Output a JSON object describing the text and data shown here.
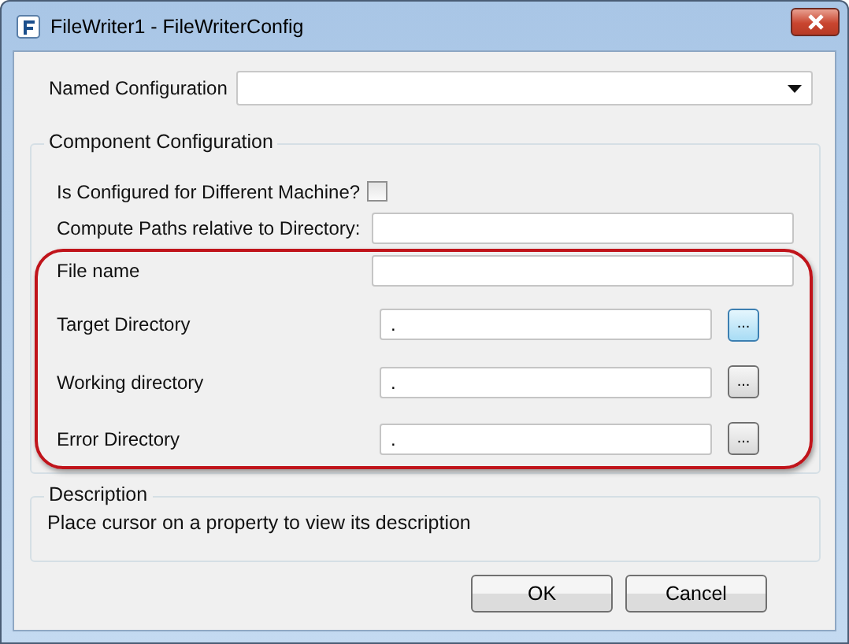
{
  "window": {
    "title": "FileWriter1 - FileWriterConfig"
  },
  "named_configuration": {
    "label": "Named Configuration"
  },
  "component_configuration": {
    "title": "Component Configuration",
    "fields": [
      {
        "kind": "checkbox",
        "label": "Is Configured for Different Machine?",
        "checked": false
      },
      {
        "kind": "text",
        "label": "Compute Paths relative to Directory:"
      }
    ],
    "highlighted_fields": [
      {
        "kind": "text",
        "label": "File name"
      },
      {
        "kind": "browse",
        "label": "Target Directory",
        "value": ".",
        "button": "...",
        "focused": true
      },
      {
        "kind": "browse",
        "label": "Working directory",
        "value": ".",
        "button": "...",
        "focused": false
      },
      {
        "kind": "browse",
        "label": "Error Directory",
        "value": ".",
        "button": "...",
        "focused": false
      }
    ]
  },
  "description": {
    "title": "Description",
    "text": "Place cursor on a property to view its description"
  },
  "buttons": [
    "OK",
    "Cancel"
  ]
}
